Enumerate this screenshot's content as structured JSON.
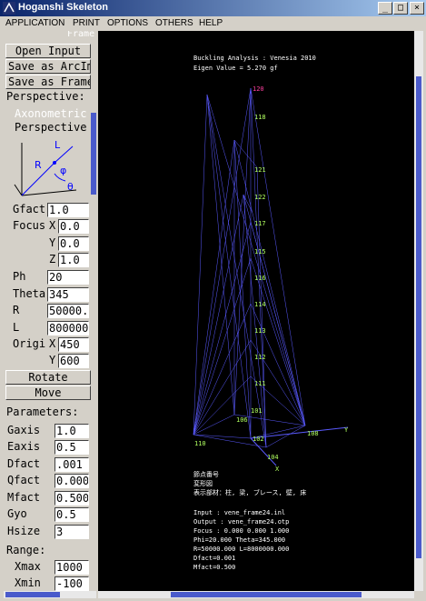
{
  "window": {
    "title": "Hoganshi Skeleton",
    "btn_min": "_",
    "btn_max": "□",
    "btn_close": "×"
  },
  "menu": [
    "APPLICATION",
    "PRINT",
    "OPTIONS",
    "OTHERS",
    "HELP"
  ],
  "panel": {
    "frame_partial": "Frame",
    "open_input": "Open Input",
    "save_arclm": "Save as ArcIm",
    "save_frame": "Save as Frame",
    "perspective_label": "Perspective:",
    "axonometric": "Axonometric",
    "perspective": "Perspective",
    "gfact_label": "Gfact",
    "gfact": "1.0",
    "focus_label": "Focus",
    "focus_x_label": "X",
    "focus_x": "0.0",
    "focus_y_label": "Y",
    "focus_y": "0.0",
    "focus_z_label": "Z",
    "focus_z": "1.0",
    "ph_label": "Ph",
    "ph": "20",
    "theta_label": "Theta",
    "theta": "345",
    "r_label": "R",
    "r": "50000.",
    "l_label": "L",
    "l": "800000",
    "origin_label": "Origi",
    "origin_x_label": "X",
    "origin_x": "450",
    "origin_y_label": "Y",
    "origin_y": "600",
    "rotate": "Rotate",
    "move": "Move",
    "parameters_label": "Parameters:",
    "gaxis_label": "Gaxis",
    "gaxis": "1.0",
    "eaxis_label": "Eaxis",
    "eaxis": "0.5",
    "dfact_label": "Dfact",
    "dfact": ".001",
    "qfact_label": "Qfact",
    "qfact": "0.000",
    "mfact_label": "Mfact",
    "mfact": "0.500",
    "gyo_label": "Gyo",
    "gyo": "0.5",
    "hsize_label": "Hsize",
    "hsize": "3",
    "range_label": "Range:",
    "xmax_label": "Xmax",
    "xmax": "1000",
    "xmin_label": "Xmin",
    "xmin": "-100"
  },
  "diagram_labels": {
    "L": "L",
    "R": "R",
    "phi": "φ",
    "theta": "θ"
  },
  "canvas": {
    "title1": "Buckling Analysis : Venesia 2010",
    "title2": "Eigen Value = 5.270 gf",
    "node_labels": [
      "120",
      "118",
      "121",
      "122",
      "117",
      "115",
      "116",
      "114",
      "113",
      "112",
      "111",
      "101",
      "106",
      "102",
      "108",
      "110",
      "104"
    ],
    "axis_x": "X",
    "axis_y": "Y",
    "legend": [
      "節点番号",
      "変形図",
      "表示部材：柱, 梁, ブレース, 壁, 床"
    ],
    "info": [
      "Input  : vene_frame24.inl",
      "Output : vene_frame24.otp",
      "Focus  : 0.000 0.000 1.000",
      "Phi=20.000 Theta=345.000",
      "R=50000.000 L=8000000.000",
      "Dfact=0.001",
      "Mfact=0.500"
    ]
  },
  "colors": {
    "accent": "#4a5acb",
    "canvas_bg": "#000000",
    "node_label": "#b0ff60",
    "top_node": "#ff40a0"
  }
}
